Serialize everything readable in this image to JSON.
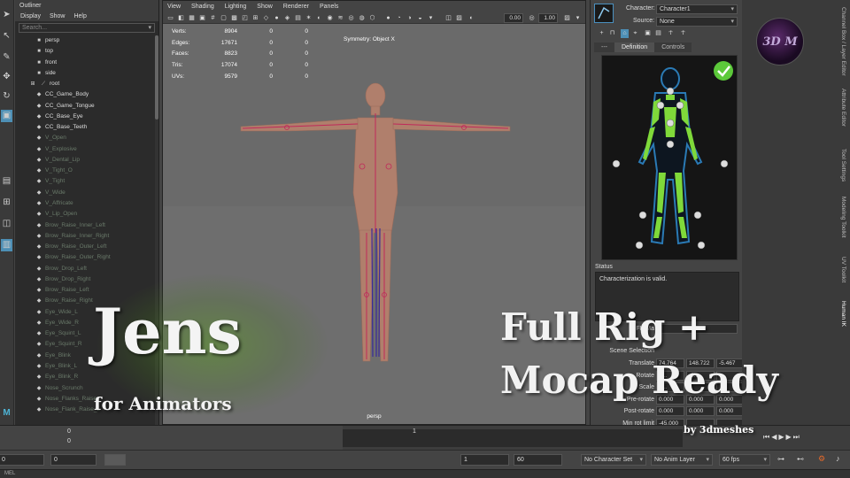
{
  "toolbox": {
    "icons": [
      "select-arrow-icon",
      "lasso-icon",
      "paint-icon",
      "move-icon",
      "rotate-icon",
      "scale-icon"
    ]
  },
  "outliner": {
    "title": "Outliner",
    "menu": [
      "Display",
      "Show",
      "Help"
    ],
    "search_placeholder": "Search...",
    "items": [
      {
        "label": "persp",
        "dim": false
      },
      {
        "label": "top",
        "dim": false
      },
      {
        "label": "front",
        "dim": false
      },
      {
        "label": "side",
        "dim": false
      },
      {
        "label": "root",
        "dim": false
      },
      {
        "label": "CC_Game_Body",
        "dim": false
      },
      {
        "label": "CC_Game_Tongue",
        "dim": false
      },
      {
        "label": "CC_Base_Eye",
        "dim": false
      },
      {
        "label": "CC_Base_Teeth",
        "dim": false
      },
      {
        "label": "V_Open",
        "dim": true
      },
      {
        "label": "V_Explosive",
        "dim": true
      },
      {
        "label": "V_Dental_Lip",
        "dim": true
      },
      {
        "label": "V_Tight_O",
        "dim": true
      },
      {
        "label": "V_Tight",
        "dim": true
      },
      {
        "label": "V_Wide",
        "dim": true
      },
      {
        "label": "V_Affricate",
        "dim": true
      },
      {
        "label": "V_Lip_Open",
        "dim": true
      },
      {
        "label": "Brow_Raise_Inner_Left",
        "dim": true
      },
      {
        "label": "Brow_Raise_Inner_Right",
        "dim": true
      },
      {
        "label": "Brow_Raise_Outer_Left",
        "dim": true
      },
      {
        "label": "Brow_Raise_Outer_Right",
        "dim": true
      },
      {
        "label": "Brow_Drop_Left",
        "dim": true
      },
      {
        "label": "Brow_Drop_Right",
        "dim": true
      },
      {
        "label": "Brow_Raise_Left",
        "dim": true
      },
      {
        "label": "Brow_Raise_Right",
        "dim": true
      },
      {
        "label": "Eye_Wide_L",
        "dim": true
      },
      {
        "label": "Eye_Wide_R",
        "dim": true
      },
      {
        "label": "Eye_Squint_L",
        "dim": true
      },
      {
        "label": "Eye_Squint_R",
        "dim": true
      },
      {
        "label": "Eye_Blink",
        "dim": true
      },
      {
        "label": "Eye_Blink_L",
        "dim": true
      },
      {
        "label": "Eye_Blink_R",
        "dim": true
      },
      {
        "label": "Nose_Scrunch",
        "dim": true
      },
      {
        "label": "Nose_Flanks_Raise",
        "dim": true
      },
      {
        "label": "Nose_Flank_Raise_L",
        "dim": true
      }
    ]
  },
  "viewport": {
    "menu": [
      "View",
      "Shading",
      "Lighting",
      "Show",
      "Renderer",
      "Panels"
    ],
    "field_a": "0.00",
    "field_b": "1.00",
    "hud": [
      {
        "label": "Verts:",
        "v1": "8904",
        "v2": "0",
        "v3": "0"
      },
      {
        "label": "Edges:",
        "v1": "17671",
        "v2": "0",
        "v3": "0"
      },
      {
        "label": "Faces:",
        "v1": "8823",
        "v2": "0",
        "v3": "0"
      },
      {
        "label": "Tris:",
        "v1": "17074",
        "v2": "0",
        "v3": "0"
      },
      {
        "label": "UVs:",
        "v1": "9579",
        "v2": "0",
        "v3": "0"
      }
    ],
    "symmetry": "Symmetry: Object X",
    "camera": "persp"
  },
  "hik": {
    "character_label": "Character:",
    "character_value": "Character1",
    "source_label": "Source:",
    "source_value": "None",
    "tabs": [
      "---",
      "Definition",
      "Controls"
    ],
    "status_label": "Status",
    "status_text": "Characterization is valid.",
    "partial_label": "FK Ma",
    "partial_value": "d",
    "scene_selection": "Scene Selection",
    "attributes": [
      {
        "label": "Translate",
        "values": [
          "74.764",
          "148.722",
          "-5.467"
        ]
      },
      {
        "label": "Rotate",
        "values": [
          "7...",
          "-0...",
          ""
        ]
      },
      {
        "label": "Scale",
        "values": [
          "1...",
          "",
          ""
        ]
      },
      {
        "label": "Pre-rotate",
        "values": [
          "0.000",
          "0.000",
          "0.000"
        ]
      },
      {
        "label": "Post-rotate",
        "values": [
          "0.000",
          "0.000",
          "0.000"
        ]
      },
      {
        "label": "Min rot limit",
        "values": [
          "-45.000",
          "",
          ""
        ]
      }
    ]
  },
  "side_tabs": [
    "Channel Box / Layer Editor",
    "Attribute Editor",
    "Tool Settings",
    "Modeling Toolkit",
    "UV Toolkit",
    "Human IK"
  ],
  "logo_text": "3D M",
  "timeline": {
    "start_frame": "0",
    "current_frame": "0",
    "right_tick": "1"
  },
  "rangebar": {
    "start": "0",
    "anim_start": "0",
    "play_start": "1",
    "play_end": "60",
    "character_set": "No Character Set",
    "anim_layer": "No Anim Layer",
    "fps": "60 fps"
  },
  "cmdline": "MEL",
  "overlay": {
    "title": "Jens",
    "subtitle": "for Animators",
    "headline_1": "Full Rig +",
    "headline_2": "Mocap Ready",
    "credit": "by 3dmeshes"
  },
  "colors": {
    "accent": "#4d8fb5",
    "green_bones": "#7fd93a",
    "check_green": "#5cc93a",
    "skin": "#b08270",
    "joint": "#c0285a"
  }
}
